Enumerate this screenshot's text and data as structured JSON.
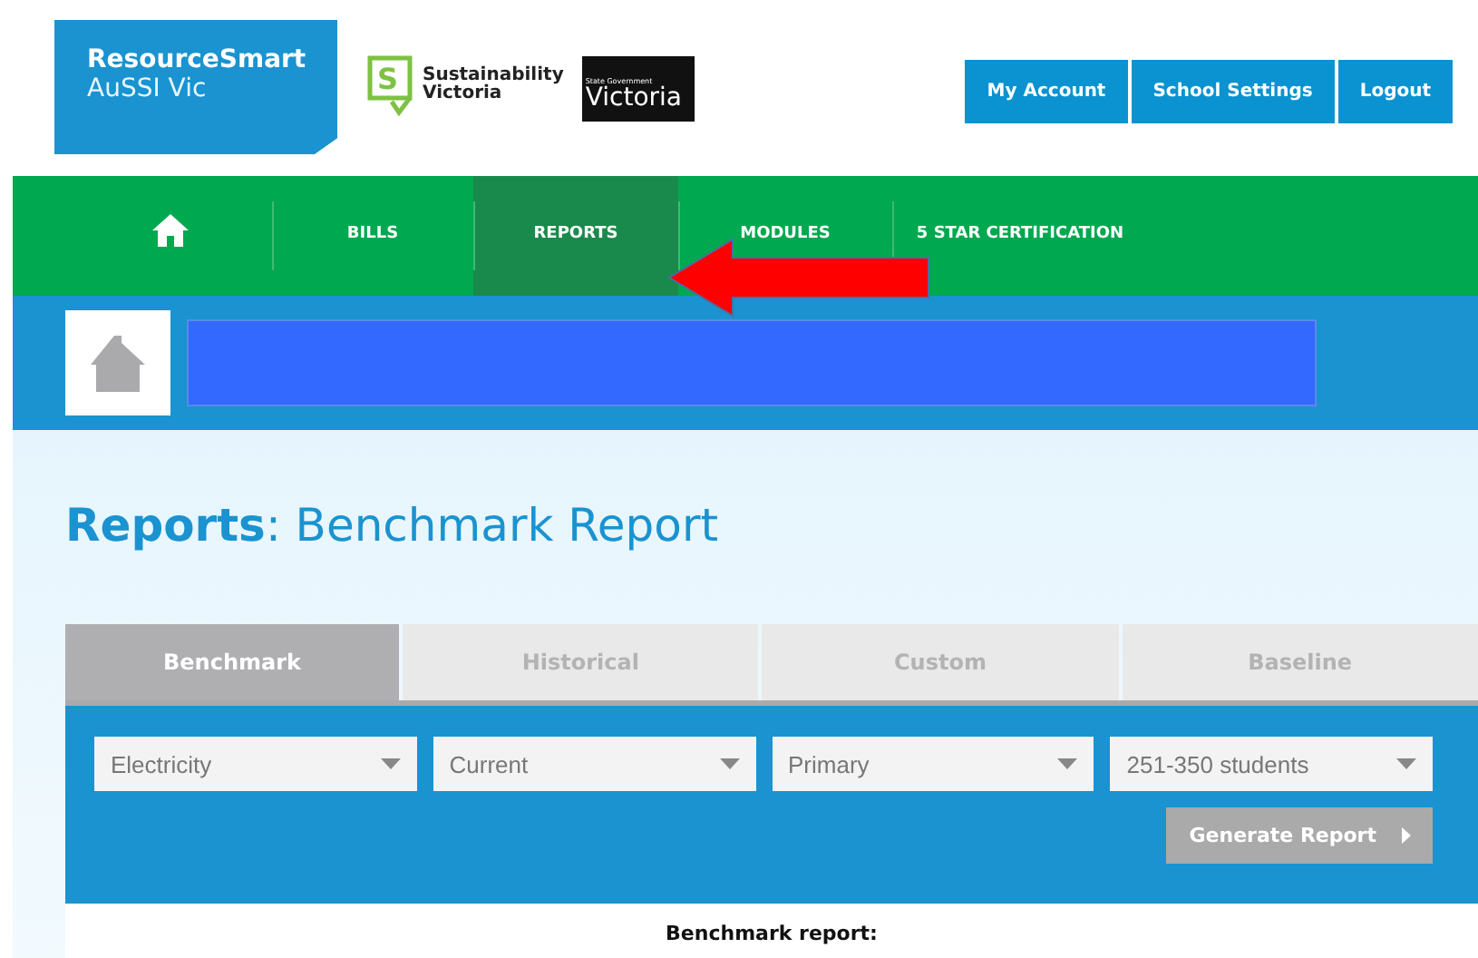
{
  "logo": {
    "title": "ResourceSmart",
    "subtitle": "AuSSI Vic"
  },
  "partner_logos": [
    {
      "kind": "sv",
      "mark": "S",
      "line1": "Sustainability",
      "line2": "Victoria"
    },
    {
      "kind": "vic",
      "line1": "State Government",
      "line2": "Victoria"
    }
  ],
  "account_buttons": [
    "My Account",
    "School Settings",
    "Logout"
  ],
  "nav": [
    {
      "kind": "home",
      "selected": false
    },
    {
      "kind": "text",
      "label": "BILLS",
      "selected": false
    },
    {
      "kind": "text",
      "label": "REPORTS",
      "selected": true
    },
    {
      "kind": "text",
      "label": "MODULES",
      "selected": false
    },
    {
      "kind": "text",
      "label": "5 STAR CERTIFICATION",
      "selected": false
    }
  ],
  "page_title": {
    "section": "Reports",
    "name": ": Benchmark Report"
  },
  "tabs": [
    {
      "label": "Benchmark",
      "selected": true
    },
    {
      "label": "Historical",
      "selected": false
    },
    {
      "label": "Custom",
      "selected": false
    },
    {
      "label": "Baseline",
      "selected": false
    }
  ],
  "filters": [
    {
      "value": "Electricity"
    },
    {
      "value": "Current"
    },
    {
      "value": "Primary"
    },
    {
      "value": "251-350 students"
    }
  ],
  "generate_button": "Generate Report",
  "report_heading": "Benchmark report:"
}
